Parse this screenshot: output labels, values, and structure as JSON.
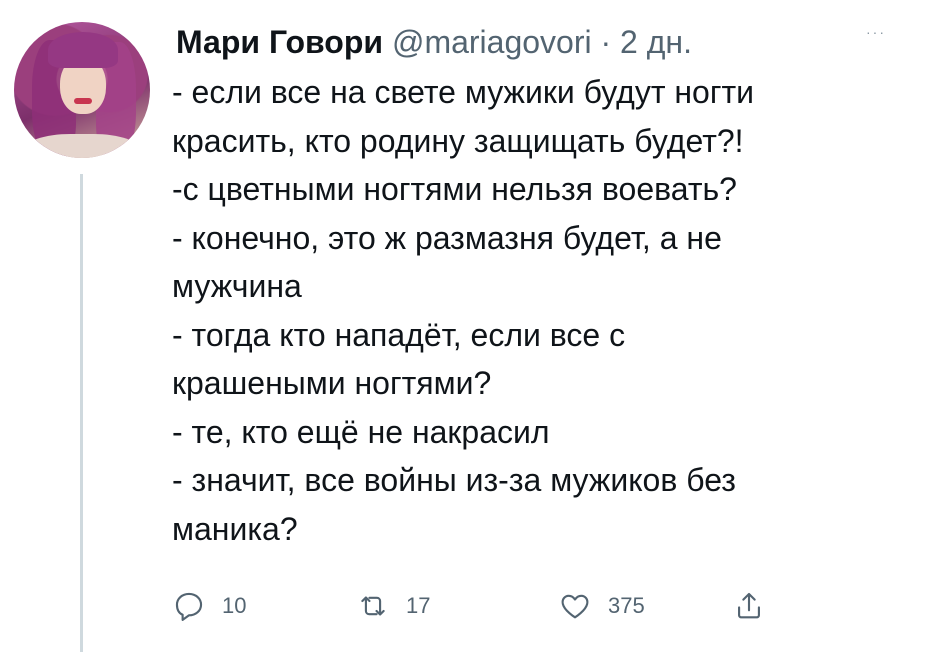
{
  "tweet": {
    "author_name": "Мари Говори",
    "handle": "@mariagovori",
    "separator": "·",
    "time": "2 дн.",
    "text_lines": [
      "- если все на свете мужики будут ногти",
      "красить, кто родину защищать будет?!",
      "-с цветными ногтями нельзя воевать?",
      "- конечно, это ж размазня будет, а не",
      "мужчина",
      "- тогда кто нападёт, если все с",
      "крашеными ногтями?",
      "- те, кто ещё не накрасил",
      "- значит, все войны из-за мужиков без",
      "маника?"
    ],
    "more_icon": "more-dots-icon",
    "more_label": "···"
  },
  "actions": {
    "reply": {
      "icon": "reply-icon",
      "count": "10"
    },
    "retweet": {
      "icon": "retweet-icon",
      "count": "17"
    },
    "like": {
      "icon": "heart-icon",
      "count": "375"
    },
    "share": {
      "icon": "share-icon",
      "count": ""
    }
  },
  "colors": {
    "text": "#0f1419",
    "secondary": "#536471",
    "thread_line": "#cfd9de"
  }
}
